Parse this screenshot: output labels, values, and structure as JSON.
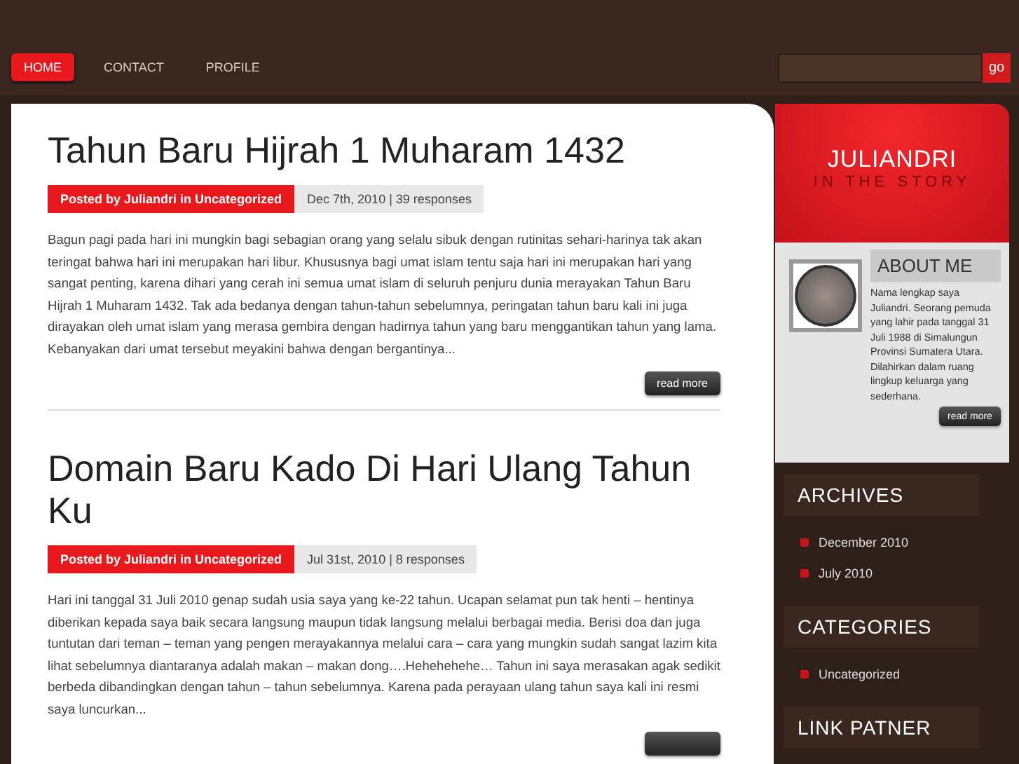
{
  "nav": {
    "items": [
      {
        "label": "HOME",
        "selected": true
      },
      {
        "label": "CONTACT",
        "selected": false
      },
      {
        "label": "PROFILE",
        "selected": false
      }
    ],
    "search_button": "go"
  },
  "posts": [
    {
      "title": "Tahun Baru Hijrah 1 Muharam 1432",
      "byline": "Posted by Juliandri in Uncategorized",
      "meta": "Dec 7th, 2010 | 39 responses",
      "excerpt": "Bagun pagi pada hari ini mungkin bagi sebagian orang yang selalu sibuk dengan rutinitas sehari-harinya tak akan teringat bahwa hari ini merupakan hari libur. Khususnya bagi umat islam tentu saja hari ini merupakan hari yang sangat penting, karena dihari yang cerah ini semua umat islam di seluruh penjuru dunia merayakan Tahun Baru Hijrah 1 Muharam 1432. Tak ada bedanya dengan tahun-tahun sebelumnya, peringatan tahun baru kali ini juga dirayakan oleh umat islam yang merasa gembira dengan hadirnya tahun yang baru menggantikan tahun yang lama. Kebanyakan dari umat tersebut meyakini bahwa dengan bergantinya...",
      "read_more": "read more"
    },
    {
      "title": "Domain Baru Kado Di Hari Ulang Tahun Ku",
      "byline": "Posted by Juliandri in Uncategorized",
      "meta": "Jul 31st, 2010 | 8 responses",
      "excerpt": "Hari ini tanggal 31 Juli 2010 genap sudah usia saya yang ke-22 tahun.  Ucapan selamat pun tak henti – hentinya diberikan kepada saya baik secara langsung maupun tidak langsung melalui berbagai media. Berisi doa dan juga tuntutan dari teman – teman yang pengen merayakannya melalui cara – cara yang mungkin sudah sangat lazim kita lihat sebelumnya diantaranya adalah makan – makan dong….Hehehehehe… Tahun ini saya merasakan agak sedikit berbeda dibandingkan dengan tahun – tahun sebelumnya. Karena pada perayaan ulang tahun saya kali ini resmi saya luncurkan..."
    }
  ],
  "sidebar": {
    "logo_title": "JULIANDRI",
    "logo_subtitle": "IN THE STORY",
    "about": {
      "heading": "ABOUT ME",
      "text": "Nama lengkap saya Juliandri. Seorang pemuda yang lahir pada tanggal 31 Juli 1988 di Simalungun Provinsi Sumatera Utara. Dilahirkan dalam ruang lingkup keluarga yang sederhana.",
      "read_more": "read more"
    },
    "widgets": [
      {
        "heading": "ARCHIVES",
        "items": [
          "December 2010",
          "July 2010"
        ]
      },
      {
        "heading": "CATEGORIES",
        "items": [
          "Uncategorized"
        ]
      },
      {
        "heading": "LINK PATNER"
      }
    ]
  }
}
